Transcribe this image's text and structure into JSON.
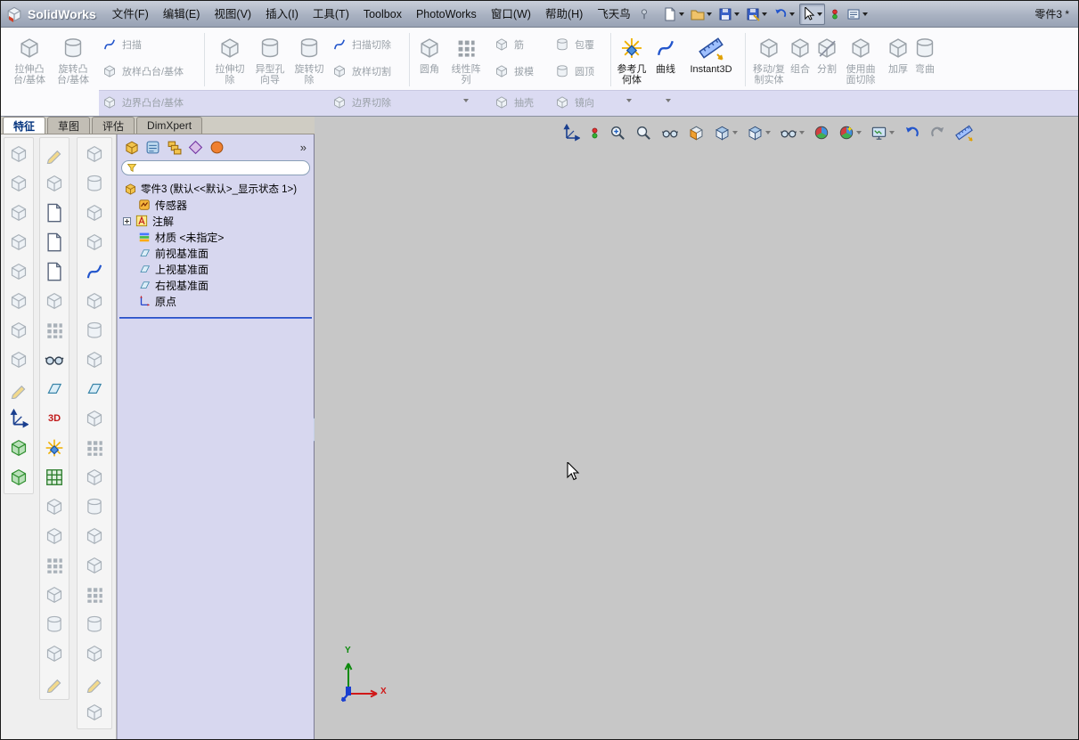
{
  "titlebar": {
    "app_name": "SolidWorks",
    "document_title": "零件3 *",
    "menus": [
      "文件(F)",
      "编辑(E)",
      "视图(V)",
      "插入(I)",
      "工具(T)",
      "Toolbox",
      "PhotoWorks",
      "窗口(W)",
      "帮助(H)",
      "飞天鸟"
    ]
  },
  "quick_toolbar": {
    "icons": [
      "new-document-icon",
      "open-icon",
      "save-icon",
      "make-drawing-icon",
      "undo-icon",
      "select-icon",
      "rebuild-icon",
      "options-icon"
    ]
  },
  "ribbon": {
    "extrude_boss": [
      "拉伸凸",
      "台/基体"
    ],
    "revolve_boss": [
      "旋转凸",
      "台/基体"
    ],
    "sweep": "扫描",
    "loft": "放样凸台/基体",
    "boundary_boss": "边界凸台/基体",
    "extrude_cut": [
      "拉伸切",
      "除"
    ],
    "hole_wizard": [
      "异型孔",
      "向导"
    ],
    "revolve_cut": [
      "旋转切",
      "除"
    ],
    "sweep_cut": "扫描切除",
    "loft_cut": "放样切割",
    "boundary_cut": "边界切除",
    "fillet": [
      "圆角",
      ""
    ],
    "linear_pattern": [
      "线性阵",
      "列"
    ],
    "rib": "筋",
    "draft": "拔模",
    "shell": "抽壳",
    "wrap": "包覆",
    "dome": "圆顶",
    "mirror": "镜向",
    "reference_geometry": [
      "参考几",
      "何体"
    ],
    "curves": [
      "曲线",
      ""
    ],
    "instant3d": [
      "Instant3D",
      ""
    ],
    "move_copy": [
      "移动/复",
      "制实体"
    ],
    "combine": [
      "组合",
      ""
    ],
    "split": [
      "分割",
      ""
    ],
    "cut_with_surface": [
      "使用曲",
      "面切除"
    ],
    "thicken": [
      "加厚",
      ""
    ],
    "flex": [
      "弯曲",
      ""
    ]
  },
  "tabs": [
    "特征",
    "草图",
    "评估",
    "DimXpert"
  ],
  "feature_panel": {
    "chevron": "»",
    "filter_value": "",
    "tab_icons": [
      "featuremanager-tab-icon",
      "propertymanager-tab-icon",
      "configurationmanager-tab-icon",
      "dimxpertmanager-tab-icon",
      "displaymanager-tab-icon"
    ],
    "tree": {
      "root": "零件3  (默认<<默认>_显示状态 1>)",
      "items": [
        "传感器",
        "注解",
        "材质 <未指定>",
        "前视基准面",
        "上视基准面",
        "右视基准面",
        "原点"
      ]
    }
  },
  "left_toolbar": {
    "threed_label": "3D",
    "icons": [
      "standard-views-icons",
      "sketch-tool-icons",
      "feature-tool-icons"
    ]
  },
  "graphics": {
    "triad": {
      "x_label": "X",
      "y_label": "Y"
    },
    "headsup_icons": [
      "axes-icon",
      "stoplight-icon",
      "zoom-fit-icon",
      "zoom-area-icon",
      "previous-view-icon",
      "section-view-icon",
      "edit-appearance-icon",
      "view-orientation-icon",
      "hide-show-items-icon",
      "appearance-sphere-icon",
      "apply-scene-icon",
      "view-settings-icon",
      "undo-view-icon",
      "redo-view-icon",
      "measure-icon"
    ]
  },
  "colors": {
    "strip": "#dbdbf2",
    "panel": "#d7d7ef",
    "graphics_bg": "#c7c7c7",
    "rollback": "#4a6fe0",
    "titlebar": "#a9b2c2"
  }
}
